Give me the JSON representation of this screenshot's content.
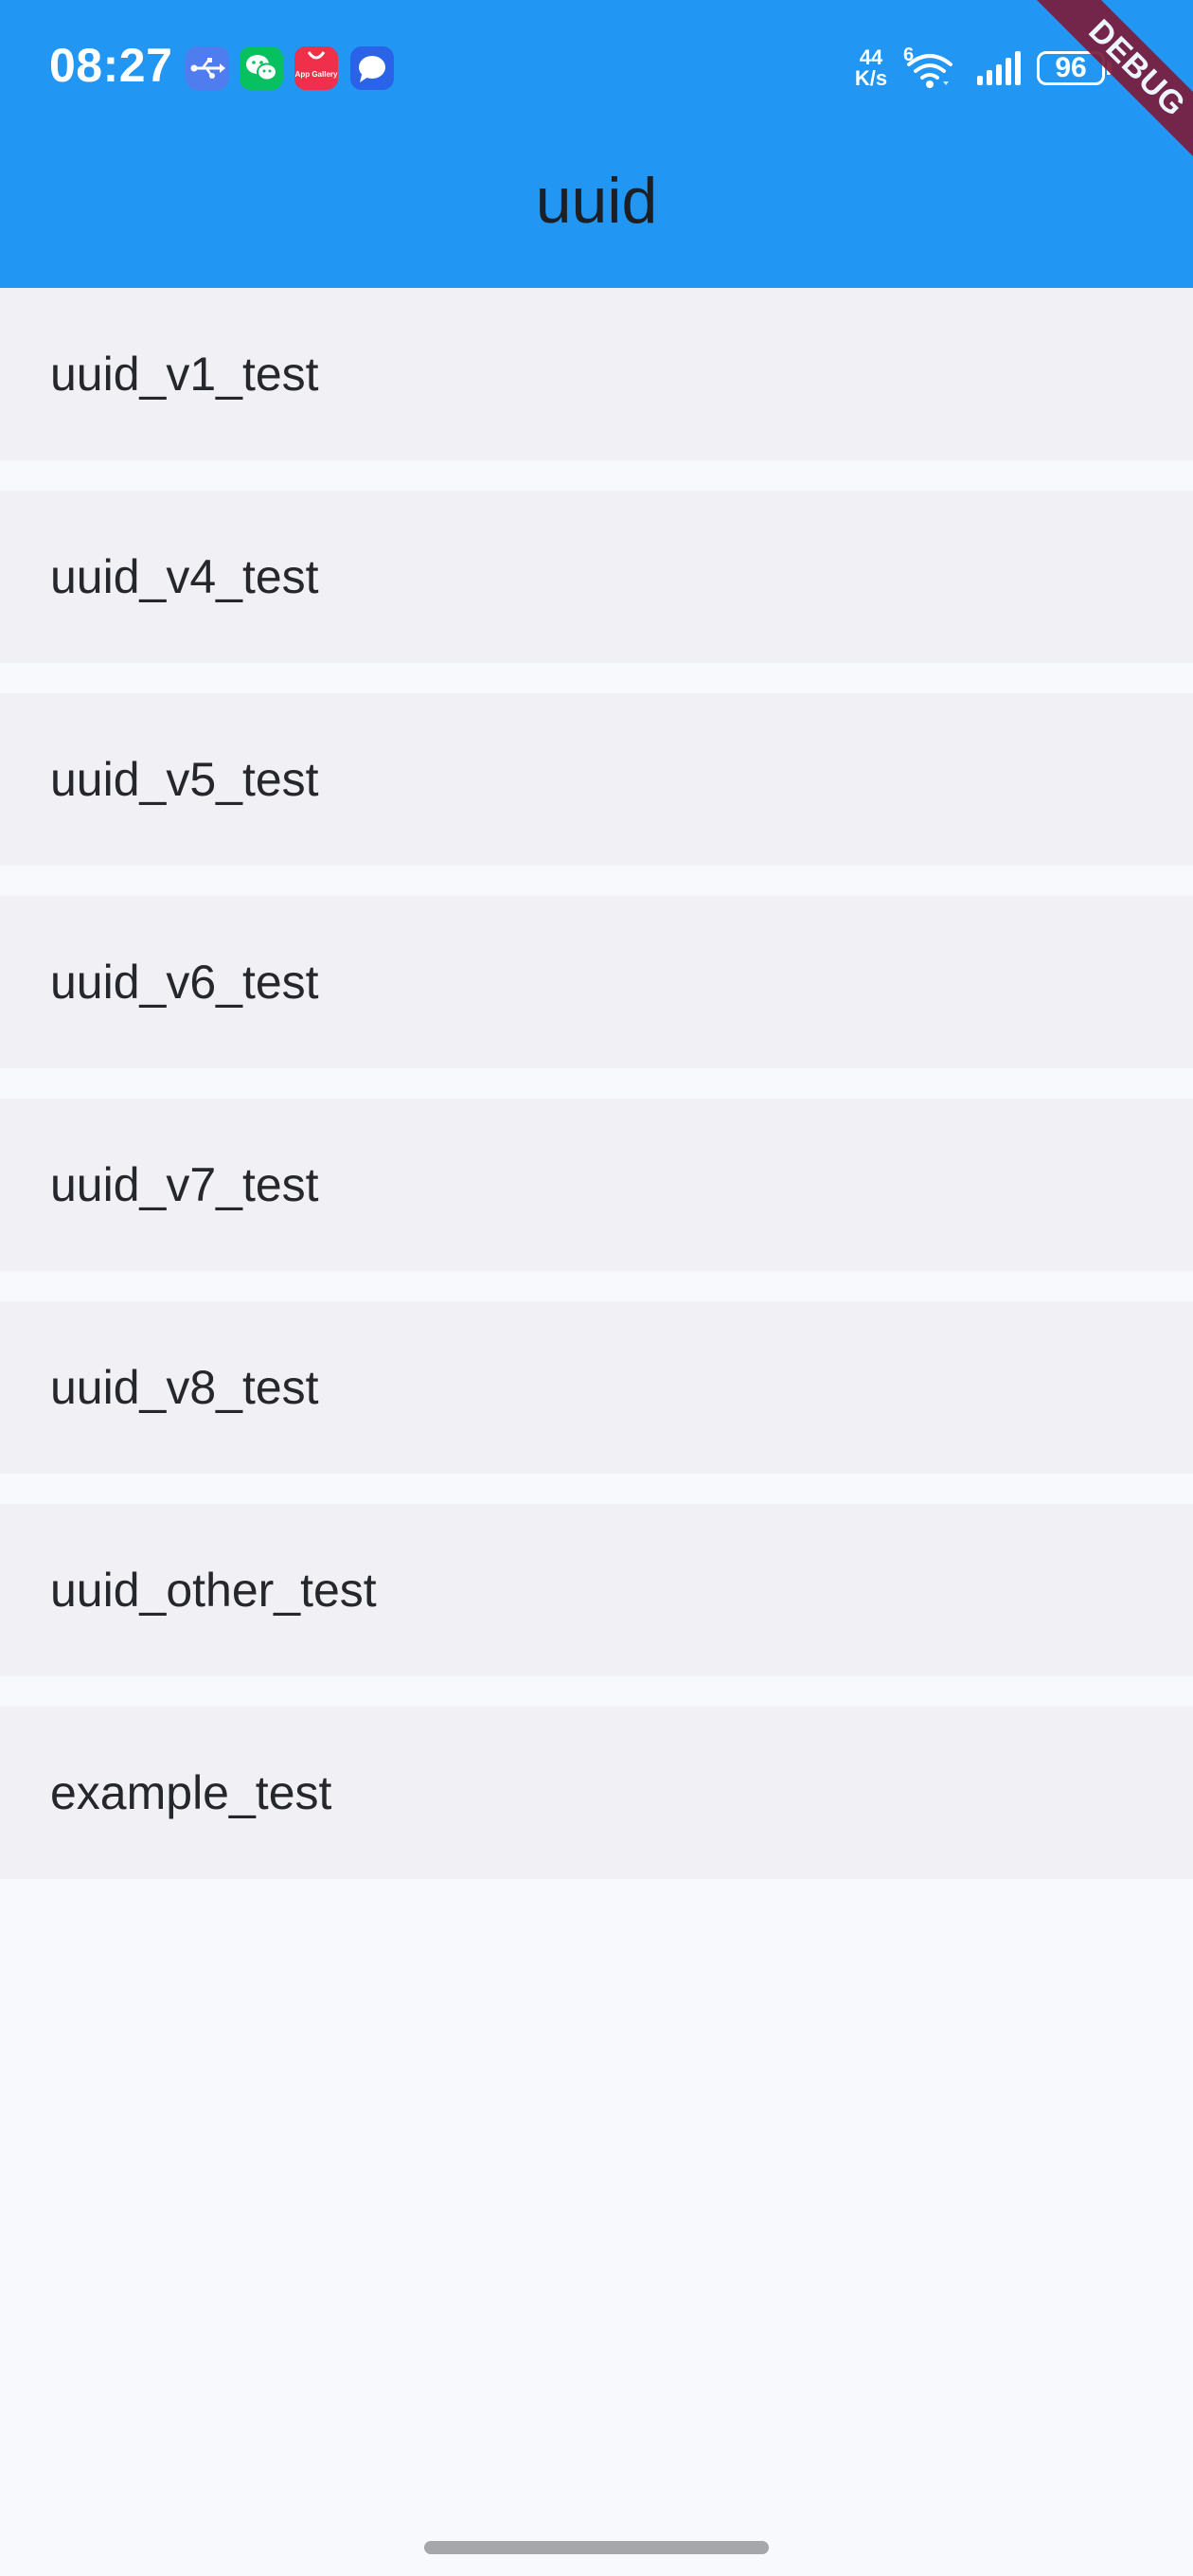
{
  "status_bar": {
    "time": "08:27",
    "notification_icons": [
      "usb-icon",
      "wechat-icon",
      "app-gallery-icon",
      "messages-icon"
    ],
    "gallery_icon_text": "App Gallery",
    "net_speed_value": "44",
    "net_speed_unit": "K/s",
    "wifi_generation": "6",
    "battery": "96"
  },
  "debug_banner": "DEBUG",
  "app_bar": {
    "title": "uuid",
    "color": "#2196f3"
  },
  "tests": [
    {
      "label": "uuid_v1_test"
    },
    {
      "label": "uuid_v4_test"
    },
    {
      "label": "uuid_v5_test"
    },
    {
      "label": "uuid_v6_test"
    },
    {
      "label": "uuid_v7_test"
    },
    {
      "label": "uuid_v8_test"
    },
    {
      "label": "uuid_other_test"
    },
    {
      "label": "example_test"
    }
  ]
}
